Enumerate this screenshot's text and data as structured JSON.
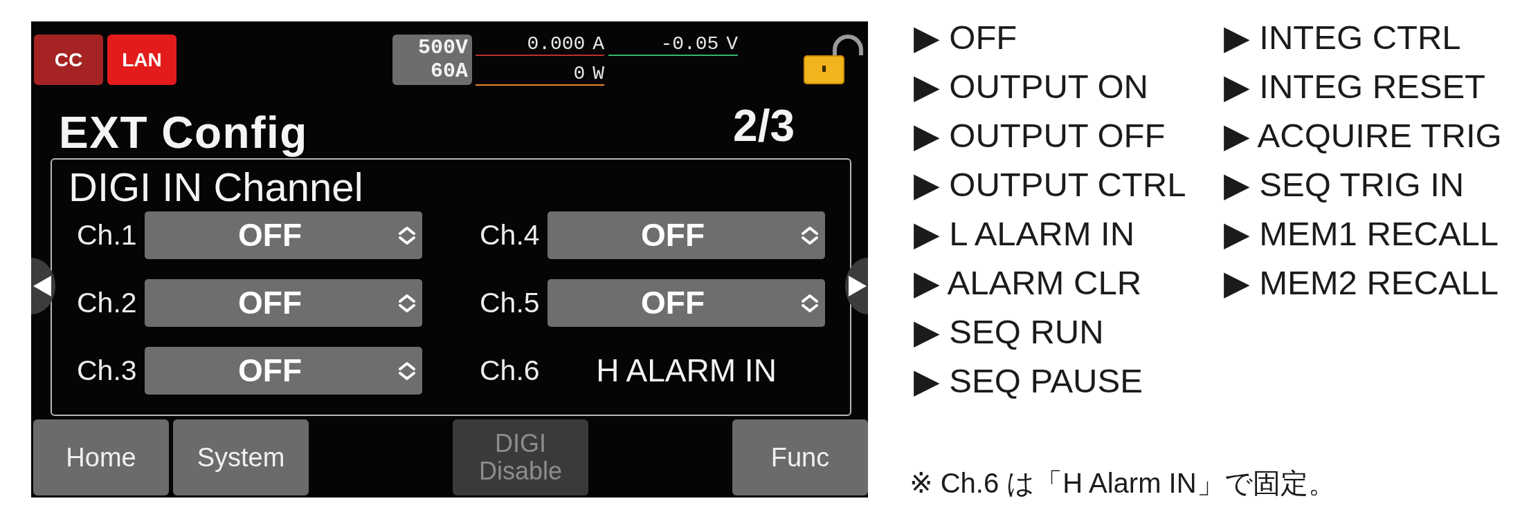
{
  "status_bar": {
    "badges": [
      {
        "text": "CC",
        "color": "#a52323"
      },
      {
        "text": "LAN",
        "color": "#e31b1b"
      }
    ],
    "range": [
      "500V",
      "60A"
    ],
    "readings": [
      {
        "text": "0.000 A",
        "color": "#b8312f"
      },
      {
        "text": "-0.05 V",
        "color": "#35b56a"
      },
      {
        "text": "0 W",
        "color": "#e8892b"
      }
    ],
    "lock": {
      "locked": false
    }
  },
  "title": "EXT Config",
  "page": "2/3",
  "panel": {
    "title": "DIGI IN Channel",
    "channels": [
      {
        "label": "Ch.1",
        "kind": "select",
        "value": "OFF"
      },
      {
        "label": "Ch.2",
        "kind": "select",
        "value": "OFF"
      },
      {
        "label": "Ch.3",
        "kind": "select",
        "value": "OFF"
      },
      {
        "label": "Ch.4",
        "kind": "select",
        "value": "OFF"
      },
      {
        "label": "Ch.5",
        "kind": "select",
        "value": "OFF"
      },
      {
        "label": "Ch.6",
        "kind": "fixed",
        "value": "H ALARM IN"
      }
    ]
  },
  "soft_keys": [
    {
      "label": "Home",
      "disabled": false
    },
    {
      "label": "System",
      "disabled": false
    },
    {
      "label": "DIGI Disable",
      "disabled": true
    },
    {
      "label": "Func",
      "disabled": false
    }
  ],
  "options": [
    "▶ OFF",
    "▶ OUTPUT ON",
    "▶ OUTPUT OFF",
    "▶ OUTPUT CTRL",
    "▶ L ALARM IN",
    "▶ ALARM CLR",
    "▶ SEQ RUN",
    "▶ SEQ PAUSE",
    "▶ INTEG CTRL",
    "▶ INTEG RESET",
    "▶ ACQUIRE TRIG",
    "▶ SEQ TRIG IN",
    "▶ MEM1 RECALL",
    "▶ MEM2 RECALL"
  ],
  "note": "※ Ch.6 は「H Alarm IN」で固定。"
}
